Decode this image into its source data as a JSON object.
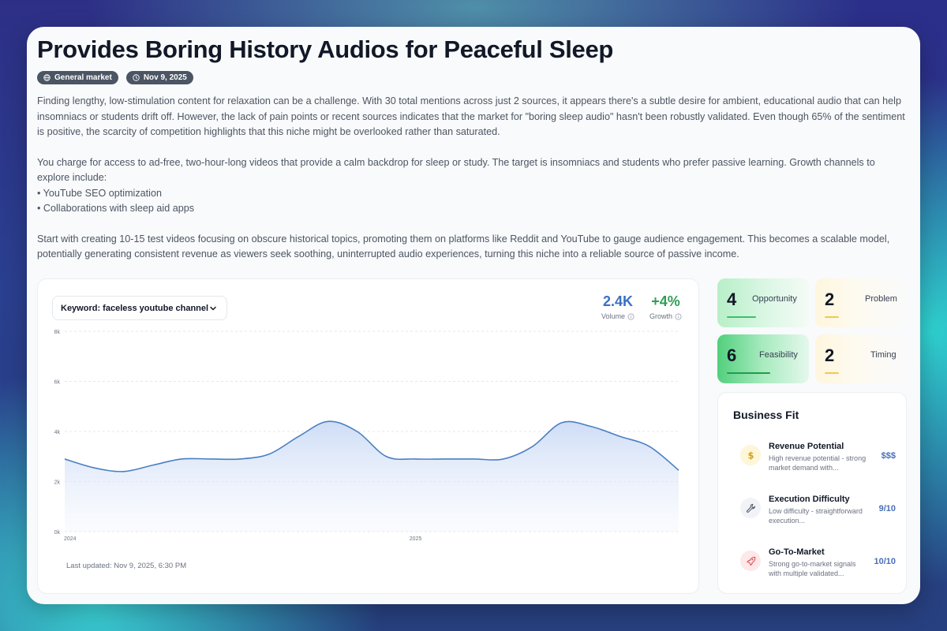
{
  "page": {
    "title": "Provides Boring History Audios for Peaceful Sleep",
    "badges": [
      {
        "label": "General market",
        "icon": "globe-icon"
      },
      {
        "label": "Nov 9, 2025",
        "icon": "clock-icon"
      }
    ],
    "paragraphs": {
      "p1": "Finding lengthy, low-stimulation content for relaxation can be a challenge. With 30 total mentions across just 2 sources, it appears there's a subtle desire for ambient, educational audio that can help insomniacs or students drift off. However, the lack of pain points or recent sources indicates that the market for \"boring sleep audio\" hasn't been robustly validated. Even though 65% of the sentiment is positive, the scarcity of competition highlights that this niche might be overlooked rather than saturated.",
      "p2_intro": "You charge for access to ad-free, two-hour-long videos that provide a calm backdrop for sleep or study. The target is insomniacs and students who prefer passive learning. Growth channels to explore include:",
      "bullet1": "• YouTube SEO optimization",
      "bullet2": "• Collaborations with sleep aid apps",
      "p3": "Start with creating 10-15 test videos focusing on obscure historical topics, promoting them on platforms like Reddit and YouTube to gauge audience engagement. This becomes a scalable model, potentially generating consistent revenue as viewers seek soothing, uninterrupted audio experiences, turning this niche into a reliable source of passive income."
    }
  },
  "trend": {
    "keyword_label": "Keyword: faceless youtube channel",
    "volume_value": "2.4K",
    "volume_label": "Volume",
    "growth_value": "+4%",
    "growth_label": "Growth",
    "last_updated": "Last updated: Nov 9, 2025, 6:30 PM",
    "colors": {
      "volume": "#3b6fc4",
      "growth": "#2f9e55",
      "line": "#4a7fc1"
    }
  },
  "chart_data": {
    "type": "area",
    "x": [
      "2024-01",
      "2024-02",
      "2024-03",
      "2024-04",
      "2024-05",
      "2024-06",
      "2024-07",
      "2024-08",
      "2024-09",
      "2024-10",
      "2024-11",
      "2024-12",
      "2025-01",
      "2025-02",
      "2025-03",
      "2025-04",
      "2025-05",
      "2025-06",
      "2025-07",
      "2025-08",
      "2025-09",
      "2025-10"
    ],
    "values": [
      2900,
      2550,
      2400,
      2650,
      2900,
      2900,
      2900,
      3100,
      3800,
      4400,
      4000,
      3000,
      2900,
      2900,
      2900,
      2900,
      3400,
      4350,
      4200,
      3800,
      3400,
      2450
    ],
    "x_ticks": [
      "2024",
      "2025"
    ],
    "y_ticks": [
      "0k",
      "2k",
      "4k",
      "6k",
      "8k"
    ],
    "ylim": [
      0,
      8000
    ],
    "grid": true
  },
  "scores": [
    {
      "value": "4",
      "label": "Opportunity",
      "fraction": 0.4
    },
    {
      "value": "2",
      "label": "Problem",
      "fraction": 0.2
    },
    {
      "value": "6",
      "label": "Feasibility",
      "fraction": 0.6
    },
    {
      "value": "2",
      "label": "Timing",
      "fraction": 0.2
    }
  ],
  "business_fit": {
    "title": "Business Fit",
    "rows": [
      {
        "title": "Revenue Potential",
        "desc": "High revenue potential - strong market demand with...",
        "value": "$$$",
        "icon": "dollar-icon"
      },
      {
        "title": "Execution Difficulty",
        "desc": "Low difficulty - straightforward execution...",
        "value": "9/10",
        "icon": "wrench-icon"
      },
      {
        "title": "Go-To-Market",
        "desc": "Strong go-to-market signals with multiple validated...",
        "value": "10/10",
        "icon": "rocket-icon"
      }
    ]
  }
}
